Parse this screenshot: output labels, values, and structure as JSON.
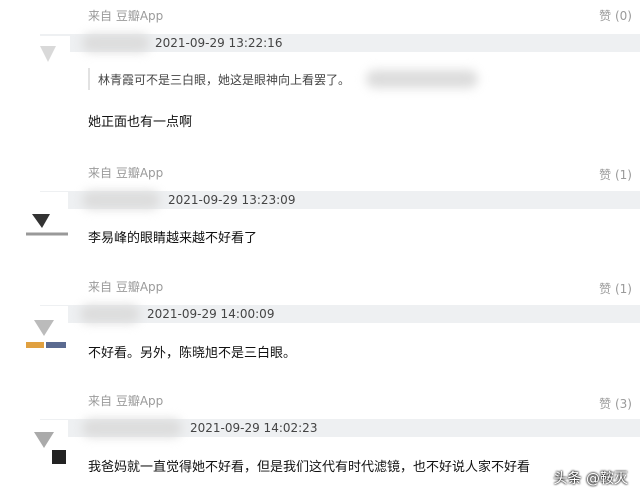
{
  "comments": [
    {
      "source": "来自 豆瓣App",
      "likes": "赞 (0)",
      "time": "2021-09-29 13:22:16",
      "quote": "林青霞可不是三白眼，她这是眼神向上看罢了。",
      "text": "她正面也有一点啊"
    },
    {
      "source": "来自 豆瓣App",
      "likes": "赞 (1)",
      "time": "2021-09-29 13:23:09",
      "text": "李易峰的眼睛越来越不好看了"
    },
    {
      "source": "来自 豆瓣App",
      "likes": "赞 (1)",
      "time": "2021-09-29 14:00:09",
      "text": "不好看。另外，陈晓旭不是三白眼。"
    },
    {
      "source": "来自 豆瓣App",
      "likes": "赞 (3)",
      "time": "2021-09-29 14:02:23",
      "text": "我爸妈就一直觉得她不好看，但是我们这代有时代滤镜，也不好说人家不好看"
    }
  ],
  "watermark": "头条 @鞍灭"
}
